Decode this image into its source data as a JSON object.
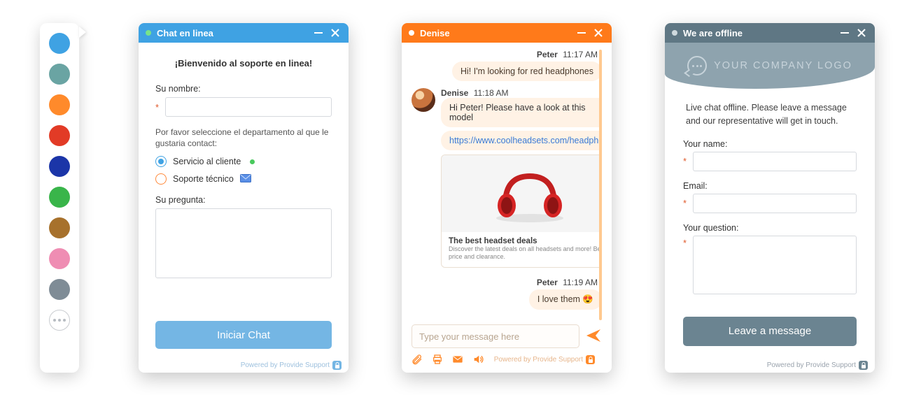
{
  "colors": {
    "swatches": [
      "#3fa2e3",
      "#6aa4a3",
      "#ff8a2b",
      "#e23b26",
      "#1b35a8",
      "#39b54a",
      "#a7712c",
      "#ef8db3",
      "#7f8c96"
    ]
  },
  "w1": {
    "title": "Chat en linea",
    "welcome": "¡Bienvenido al soporte en linea!",
    "name_label": "Su nombre:",
    "dept_note": "Por favor seleccione el departamento al que le gustaria contact:",
    "dept_a": "Servicio al cliente",
    "dept_b": "Soporte técnico",
    "question_label": "Su pregunta:",
    "start_btn": "Iniciar Chat",
    "powered": "Powered by Provide Support"
  },
  "w2": {
    "title": "Denise",
    "user_name": "Peter",
    "agent_name": "Denise",
    "t1": "11:17 AM",
    "t2": "11:18 AM",
    "t3": "11:19 AM",
    "msg1": "Hi! I'm looking for red headphones",
    "msg2": "Hi Peter! Please have a look at this model",
    "link": "https://www.coolheadsets.com/headpho...",
    "card_title": "The best headset deals",
    "card_desc": "Discover the latest deals on all headsets and more! Best price and clearance.",
    "msg3": "I love them  😍",
    "placeholder": "Type your message here",
    "powered": "Powered by Provide Support"
  },
  "w3": {
    "title": "We are offline",
    "logo_text": "YOUR COMPANY LOGO",
    "offline_msg": "Live chat offline. Please leave a message and our representative will get in touch.",
    "name_label": "Your name:",
    "email_label": "Email:",
    "question_label": "Your question:",
    "leave_btn": "Leave a message",
    "powered": "Powered by Provide Support"
  }
}
